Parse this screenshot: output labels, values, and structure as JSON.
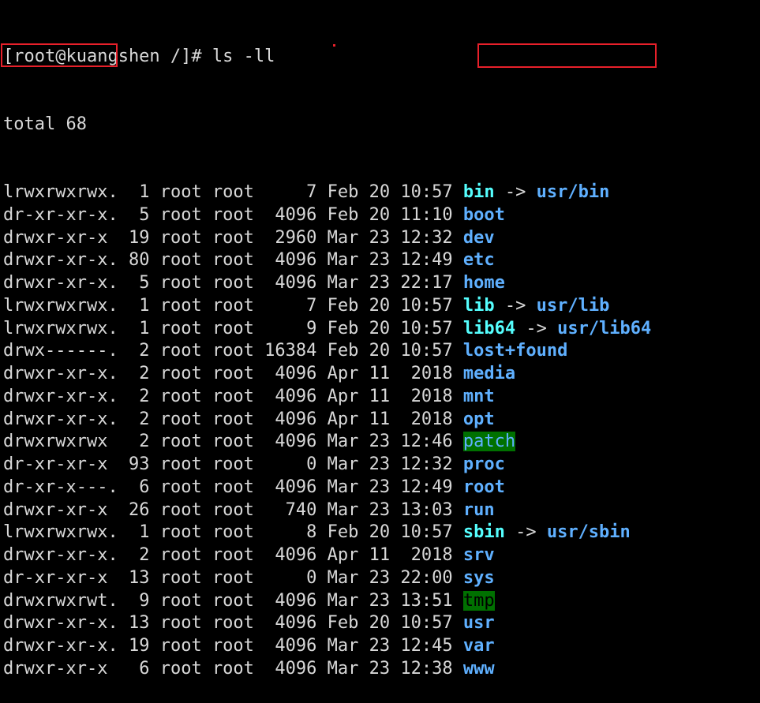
{
  "terminal": {
    "prompt": "[root@kuangshen /]# ls -ll",
    "total": "total 68",
    "colors": {
      "background": "#000000",
      "text": "#d8d8d8",
      "directory": "#5fb0ff",
      "symlink": "#55ffff",
      "sticky_other_writable_bg": "#007000",
      "annotation": "#e8202a"
    },
    "entries": [
      {
        "perm": "lrwxrwxrwx.",
        "links": "1",
        "owner": "root",
        "group": "root",
        "size": "7",
        "date": "Feb 20 10:57",
        "name": "bin",
        "target": "usr/bin",
        "kind": "link"
      },
      {
        "perm": "dr-xr-xr-x.",
        "links": "5",
        "owner": "root",
        "group": "root",
        "size": "4096",
        "date": "Feb 20 11:10",
        "name": "boot",
        "target": "",
        "kind": "dir"
      },
      {
        "perm": "drwxr-xr-x",
        "links": "19",
        "owner": "root",
        "group": "root",
        "size": "2960",
        "date": "Mar 23 12:32",
        "name": "dev",
        "target": "",
        "kind": "dir"
      },
      {
        "perm": "drwxr-xr-x.",
        "links": "80",
        "owner": "root",
        "group": "root",
        "size": "4096",
        "date": "Mar 23 12:49",
        "name": "etc",
        "target": "",
        "kind": "dir"
      },
      {
        "perm": "drwxr-xr-x.",
        "links": "5",
        "owner": "root",
        "group": "root",
        "size": "4096",
        "date": "Mar 23 22:17",
        "name": "home",
        "target": "",
        "kind": "dir"
      },
      {
        "perm": "lrwxrwxrwx.",
        "links": "1",
        "owner": "root",
        "group": "root",
        "size": "7",
        "date": "Feb 20 10:57",
        "name": "lib",
        "target": "usr/lib",
        "kind": "link"
      },
      {
        "perm": "lrwxrwxrwx.",
        "links": "1",
        "owner": "root",
        "group": "root",
        "size": "9",
        "date": "Feb 20 10:57",
        "name": "lib64",
        "target": "usr/lib64",
        "kind": "link"
      },
      {
        "perm": "drwx------.",
        "links": "2",
        "owner": "root",
        "group": "root",
        "size": "16384",
        "date": "Feb 20 10:57",
        "name": "lost+found",
        "target": "",
        "kind": "dir"
      },
      {
        "perm": "drwxr-xr-x.",
        "links": "2",
        "owner": "root",
        "group": "root",
        "size": "4096",
        "date": "Apr 11  2018",
        "name": "media",
        "target": "",
        "kind": "dir"
      },
      {
        "perm": "drwxr-xr-x.",
        "links": "2",
        "owner": "root",
        "group": "root",
        "size": "4096",
        "date": "Apr 11  2018",
        "name": "mnt",
        "target": "",
        "kind": "dir"
      },
      {
        "perm": "drwxr-xr-x.",
        "links": "2",
        "owner": "root",
        "group": "root",
        "size": "4096",
        "date": "Apr 11  2018",
        "name": "opt",
        "target": "",
        "kind": "dir"
      },
      {
        "perm": "drwxrwxrwx",
        "links": "2",
        "owner": "root",
        "group": "root",
        "size": "4096",
        "date": "Mar 23 12:46",
        "name": "patch",
        "target": "",
        "kind": "other-writable"
      },
      {
        "perm": "dr-xr-xr-x",
        "links": "93",
        "owner": "root",
        "group": "root",
        "size": "0",
        "date": "Mar 23 12:32",
        "name": "proc",
        "target": "",
        "kind": "dir"
      },
      {
        "perm": "dr-xr-x---.",
        "links": "6",
        "owner": "root",
        "group": "root",
        "size": "4096",
        "date": "Mar 23 12:49",
        "name": "root",
        "target": "",
        "kind": "dir"
      },
      {
        "perm": "drwxr-xr-x",
        "links": "26",
        "owner": "root",
        "group": "root",
        "size": "740",
        "date": "Mar 23 13:03",
        "name": "run",
        "target": "",
        "kind": "dir"
      },
      {
        "perm": "lrwxrwxrwx.",
        "links": "1",
        "owner": "root",
        "group": "root",
        "size": "8",
        "date": "Feb 20 10:57",
        "name": "sbin",
        "target": "usr/sbin",
        "kind": "link"
      },
      {
        "perm": "drwxr-xr-x.",
        "links": "2",
        "owner": "root",
        "group": "root",
        "size": "4096",
        "date": "Apr 11  2018",
        "name": "srv",
        "target": "",
        "kind": "dir"
      },
      {
        "perm": "dr-xr-xr-x",
        "links": "13",
        "owner": "root",
        "group": "root",
        "size": "0",
        "date": "Mar 23 22:00",
        "name": "sys",
        "target": "",
        "kind": "dir"
      },
      {
        "perm": "drwxrwxrwt.",
        "links": "9",
        "owner": "root",
        "group": "root",
        "size": "4096",
        "date": "Mar 23 13:51",
        "name": "tmp",
        "target": "",
        "kind": "sticky"
      },
      {
        "perm": "drwxr-xr-x.",
        "links": "13",
        "owner": "root",
        "group": "root",
        "size": "4096",
        "date": "Feb 20 10:57",
        "name": "usr",
        "target": "",
        "kind": "dir"
      },
      {
        "perm": "drwxr-xr-x.",
        "links": "19",
        "owner": "root",
        "group": "root",
        "size": "4096",
        "date": "Mar 23 12:45",
        "name": "var",
        "target": "",
        "kind": "dir"
      },
      {
        "perm": "drwxr-xr-x",
        "links": "6",
        "owner": "root",
        "group": "root",
        "size": "4096",
        "date": "Mar 23 12:38",
        "name": "www",
        "target": "",
        "kind": "dir"
      }
    ]
  }
}
